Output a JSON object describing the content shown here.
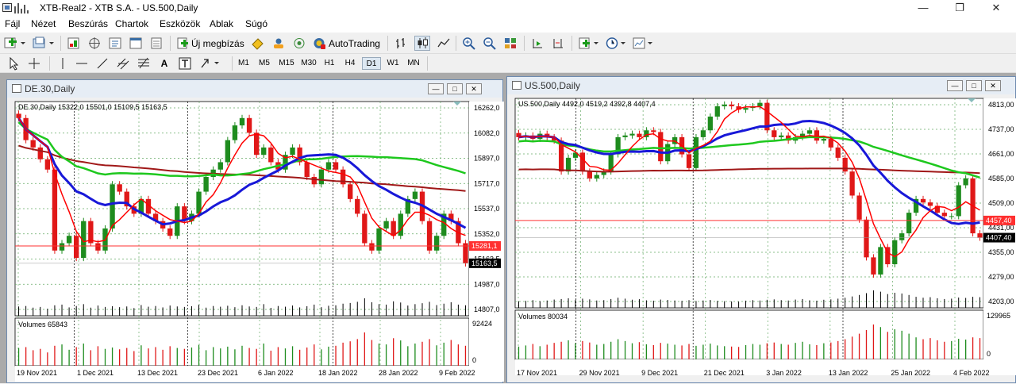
{
  "window": {
    "title": "XTB-Real2 - XTB S.A. - US.500,Daily"
  },
  "menu": [
    "Fájl",
    "Nézet",
    "Beszúrás",
    "Chartok",
    "Eszközök",
    "Ablak",
    "Súgó"
  ],
  "toolbar": {
    "new_order_label": "Új megbízás",
    "autotrading_label": "AutoTrading"
  },
  "timeframes": [
    "M1",
    "M5",
    "M15",
    "M30",
    "H1",
    "H4",
    "D1",
    "W1",
    "MN"
  ],
  "selected_timeframe": "D1",
  "colors": {
    "bull": "#1e8c1e",
    "bear": "#e01818",
    "ma_red": "#ff0000",
    "ma_blue": "#1818d8",
    "ma_green": "#1ec81e",
    "ma_brown": "#a01818",
    "grid": "#66aa66",
    "hline": "#ff3030"
  },
  "charts": [
    {
      "window_title": "DE.30,Daily",
      "info": "DE.30,Daily  15322,0 15501,0 15109,5 15163,5",
      "volume_label": "Volumes 65843",
      "price_range": [
        14807,
        16262
      ],
      "price_ticks": [
        "16262,0",
        "16082,0",
        "15897,0",
        "15717,0",
        "15537,0",
        "15352,0",
        "15163,5",
        "14987,0",
        "14807,0"
      ],
      "hline_label": "15281,1",
      "hline_value": 15281.1,
      "last_price_label": "15163,5",
      "last_price": 15163.5,
      "volume_ticks": [
        "92424",
        "0"
      ],
      "date_labels": [
        "19 Nov 2021",
        "1 Dec 2021",
        "13 Dec 2021",
        "23 Dec 2021",
        "6 Jan 2022",
        "18 Jan 2022",
        "28 Jan 2022",
        "9 Feb 2022"
      ],
      "chart_data": {
        "type": "candlestick",
        "close": [
          16150,
          16000,
          15950,
          15870,
          15800,
          15250,
          15300,
          15350,
          15200,
          15450,
          15300,
          15250,
          15400,
          15700,
          15650,
          15550,
          15500,
          15600,
          15500,
          15450,
          15400,
          15350,
          15550,
          15450,
          15500,
          15650,
          15750,
          15800,
          15850,
          16000,
          16100,
          16150,
          16050,
          15900,
          15950,
          15850,
          15800,
          15900,
          15950,
          15850,
          15750,
          15700,
          15800,
          15850,
          15800,
          15700,
          15600,
          15500,
          15300,
          15250,
          15400,
          15450,
          15350,
          15500,
          15600,
          15650,
          15450,
          15250,
          15350,
          15500,
          15450,
          15300,
          15163.5
        ],
        "volume": [
          40,
          42,
          35,
          38,
          30,
          45,
          48,
          36,
          42,
          50,
          35,
          44,
          38,
          41,
          37,
          40,
          33,
          46,
          39,
          42,
          36,
          44,
          40,
          38,
          41,
          47,
          35,
          42,
          39,
          43,
          37,
          45,
          40,
          38,
          50,
          34,
          42,
          39,
          44,
          36,
          41,
          48,
          37,
          43,
          45,
          52,
          55,
          60,
          75,
          58,
          50,
          48,
          62,
          57,
          44,
          50,
          54,
          60,
          46,
          52,
          58,
          48,
          45
        ]
      },
      "ma": {
        "red": true,
        "blue": true,
        "green": true,
        "brown": true
      }
    },
    {
      "window_title": "US.500,Daily",
      "info": "US.500,Daily  4492,0 4519,2 4392,8 4407,4",
      "volume_label": "Volumes 80034",
      "price_range": [
        4203,
        4813
      ],
      "price_ticks": [
        "4813,00",
        "4737,00",
        "4661,00",
        "4585,00",
        "4509,00",
        "4431,00",
        "4355,00",
        "4279,00",
        "4203,00"
      ],
      "hline_label": "4457,40",
      "hline_value": 4457.4,
      "last_price_label": "4407,40",
      "last_price": 4407.4,
      "volume_ticks": [
        "129965",
        "0"
      ],
      "date_labels": [
        "17 Nov 2021",
        "29 Nov 2021",
        "9 Dec 2021",
        "21 Dec 2021",
        "3 Jan 2022",
        "13 Jan 2022",
        "25 Jan 2022",
        "4 Feb 2022"
      ],
      "chart_data": {
        "type": "candlestick",
        "close": [
          4700,
          4705,
          4695,
          4710,
          4700,
          4690,
          4600,
          4640,
          4655,
          4600,
          4580,
          4590,
          4600,
          4650,
          4700,
          4705,
          4710,
          4700,
          4720,
          4715,
          4630,
          4680,
          4700,
          4650,
          4610,
          4700,
          4720,
          4760,
          4790,
          4795,
          4790,
          4780,
          4785,
          4790,
          4800,
          4720,
          4700,
          4705,
          4690,
          4700,
          4710,
          4720,
          4690,
          4695,
          4670,
          4640,
          4600,
          4530,
          4460,
          4350,
          4300,
          4380,
          4330,
          4400,
          4420,
          4480,
          4520,
          4510,
          4500,
          4480,
          4470,
          4470,
          4560,
          4580,
          4420,
          4407.4
        ],
        "volume": [
          35,
          38,
          42,
          36,
          40,
          45,
          48,
          52,
          44,
          50,
          46,
          40,
          42,
          48,
          55,
          50,
          44,
          47,
          41,
          39,
          45,
          43,
          40,
          38,
          42,
          37,
          40,
          43,
          38,
          36,
          35,
          34,
          39,
          42,
          40,
          44,
          46,
          42,
          40,
          45,
          48,
          41,
          39,
          44,
          46,
          50,
          55,
          62,
          70,
          80,
          95,
          88,
          75,
          82,
          78,
          70,
          60,
          55,
          58,
          52,
          48,
          50,
          56,
          54,
          60,
          58
        ]
      },
      "ma": {
        "red": true,
        "blue": true,
        "green": true,
        "brown": true
      }
    }
  ]
}
